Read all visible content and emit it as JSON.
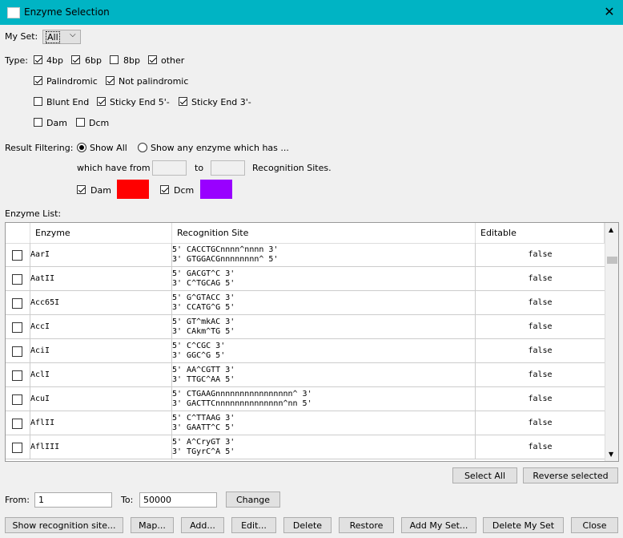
{
  "window": {
    "title": "Enzyme Selection",
    "close_glyph": "✕"
  },
  "myset": {
    "label": "My Set:",
    "value": "All"
  },
  "type": {
    "label": "Type:",
    "options": [
      {
        "label": "4bp",
        "checked": true
      },
      {
        "label": "6bp",
        "checked": true
      },
      {
        "label": "8bp",
        "checked": false
      },
      {
        "label": "other",
        "checked": true
      },
      {
        "label": "Palindromic",
        "checked": true
      },
      {
        "label": "Not palindromic",
        "checked": true
      },
      {
        "label": "Blunt End",
        "checked": false
      },
      {
        "label": "Sticky End 5'-",
        "checked": true
      },
      {
        "label": "Sticky End 3'-",
        "checked": true
      },
      {
        "label": "Dam",
        "checked": false
      },
      {
        "label": "Dcm",
        "checked": false
      }
    ]
  },
  "filter": {
    "label": "Result Filtering:",
    "show_all": "Show All",
    "show_any": "Show any enzyme which has ...",
    "which_have_from": "which have from",
    "to": "to",
    "recognition_sites": "Recognition Sites.",
    "dam_label": "Dam",
    "dcm_label": "Dcm",
    "dam_color": "#ff0000",
    "dcm_color": "#9900ff"
  },
  "enzyme_list": {
    "label": "Enzyme List:",
    "columns": [
      "Enzyme",
      "Recognition Site",
      "Editable"
    ],
    "rows": [
      {
        "name": "AarI",
        "site1": "5' CACCTGCnnnn^nnnn 3'",
        "site2": "3' GTGGACGnnnnnnnn^ 5'",
        "editable": "false"
      },
      {
        "name": "AatII",
        "site1": "5' GACGT^C 3'",
        "site2": "3' C^TGCAG 5'",
        "editable": "false"
      },
      {
        "name": "Acc65I",
        "site1": "5' G^GTACC 3'",
        "site2": "3' CCATG^G 5'",
        "editable": "false"
      },
      {
        "name": "AccI",
        "site1": "5' GT^mkAC 3'",
        "site2": "3' CAkm^TG 5'",
        "editable": "false"
      },
      {
        "name": "AciI",
        "site1": "5' C^CGC 3'",
        "site2": "3' GGC^G 5'",
        "editable": "false"
      },
      {
        "name": "AclI",
        "site1": "5' AA^CGTT 3'",
        "site2": "3' TTGC^AA 5'",
        "editable": "false"
      },
      {
        "name": "AcuI",
        "site1": "5' CTGAAGnnnnnnnnnnnnnnnn^ 3'",
        "site2": "3' GACTTCnnnnnnnnnnnnnn^nn 5'",
        "editable": "false"
      },
      {
        "name": "AflII",
        "site1": "5' C^TTAAG 3'",
        "site2": "3' GAATT^C 5'",
        "editable": "false"
      },
      {
        "name": "AflIII",
        "site1": "5' A^CryGT 3'",
        "site2": "3' TGyrC^A 5'",
        "editable": "false"
      }
    ]
  },
  "selection_buttons": {
    "select_all": "Select All",
    "reverse_selected": "Reverse selected"
  },
  "range": {
    "from_label": "From:",
    "from_value": "1",
    "to_label": "To:",
    "to_value": "50000",
    "change": "Change"
  },
  "footer": {
    "show_recognition_site": "Show recognition site...",
    "map": "Map...",
    "add": "Add...",
    "edit": "Edit...",
    "delete": "Delete",
    "restore": "Restore",
    "add_my_set": "Add My Set...",
    "delete_my_set": "Delete My Set",
    "close": "Close"
  }
}
